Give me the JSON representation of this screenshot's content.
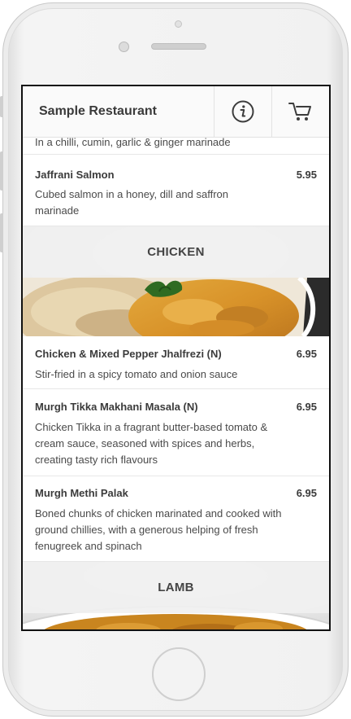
{
  "header": {
    "title": "Sample Restaurant",
    "info_icon": "info-icon",
    "cart_icon": "cart-icon"
  },
  "menu": {
    "partial_description": "In a chilli, cumin, garlic & ginger marinade",
    "salmon": {
      "name": "Jaffrani Salmon",
      "price": "5.95",
      "description": "Cubed salmon in a honey, dill and saffron marinade"
    },
    "chicken_category": "CHICKEN",
    "chicken_items": [
      {
        "name": "Chicken & Mixed Pepper Jhalfrezi (N)",
        "price": "6.95",
        "description": "Stir-fried in a spicy tomato and onion sauce"
      },
      {
        "name": "Murgh Tikka Makhani Masala (N)",
        "price": "6.95",
        "description": "Chicken Tikka in a fragrant butter-based tomato & cream sauce, seasoned with spices and herbs, creating tasty rich flavours"
      },
      {
        "name": "Murgh Methi Palak",
        "price": "6.95",
        "description": "Boned chunks of chicken marinated and cooked with ground chillies, with a generous helping of fresh fenugreek and spinach"
      }
    ],
    "lamb_category": "LAMB"
  },
  "colors": {
    "accent_text": "#3b3b3b",
    "band_background": "#f0f0f0",
    "divider": "#e7e7e7"
  }
}
